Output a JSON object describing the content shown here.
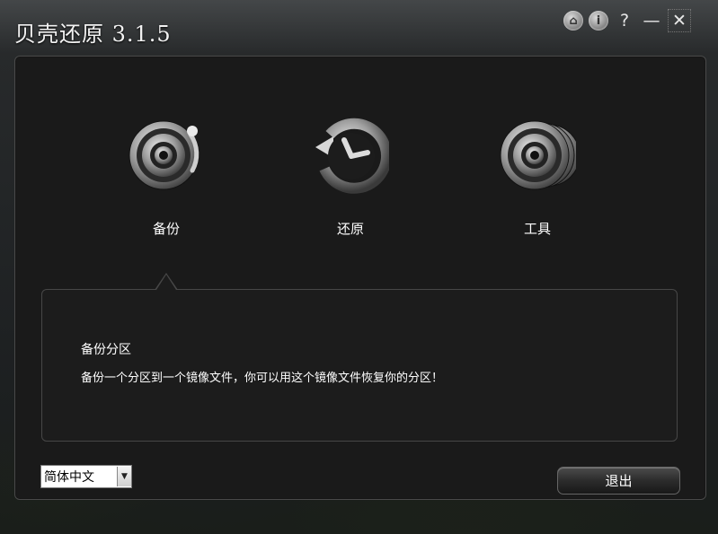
{
  "window": {
    "title": "贝壳还原 3.1.5"
  },
  "title_buttons": [
    {
      "name": "home-icon",
      "glyph": "⌂"
    },
    {
      "name": "info-icon",
      "glyph": "i"
    },
    {
      "name": "help-icon",
      "glyph": "?"
    },
    {
      "name": "minimize-icon",
      "glyph": "—"
    },
    {
      "name": "close-icon",
      "glyph": "✕"
    }
  ],
  "features": [
    {
      "label": "备份",
      "icon": "backup-disc-icon"
    },
    {
      "label": "还原",
      "icon": "restore-clock-icon"
    },
    {
      "label": "工具",
      "icon": "tools-discs-icon"
    }
  ],
  "info": {
    "title": "备份分区",
    "description": "备份一个分区到一个镜像文件，你可以用这个镜像文件恢复你的分区！"
  },
  "language": {
    "selected": "简体中文",
    "arrow": "▼"
  },
  "exit_button": {
    "label": "退出"
  },
  "colors": {
    "panel": "#1a1a1a",
    "text": "#ffffff"
  }
}
